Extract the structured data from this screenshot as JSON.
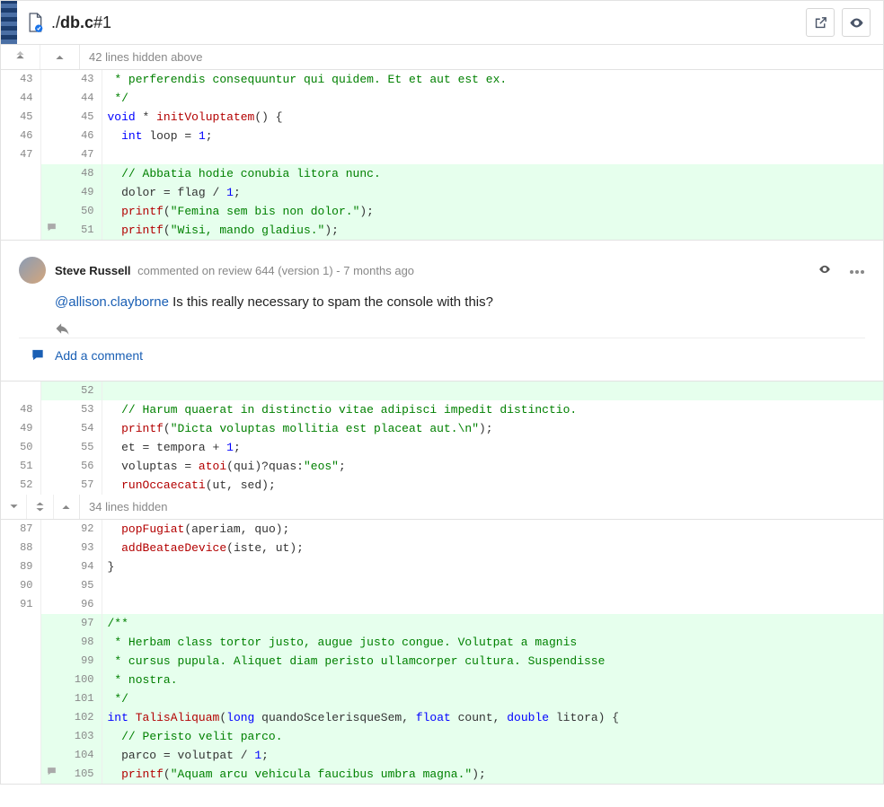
{
  "header": {
    "path_prefix": "./",
    "filename": "db.c",
    "rev_suffix": "#1"
  },
  "collapse_top": "42 lines hidden above",
  "collapse_mid": "34 lines hidden",
  "code_block1": [
    {
      "o": "43",
      "n": "43",
      "t": "ctx",
      "html": " <span class='cm'>* perferendis consequuntur qui quidem. Et et aut est ex.</span>"
    },
    {
      "o": "44",
      "n": "44",
      "t": "ctx",
      "html": " <span class='cm'>*/</span>"
    },
    {
      "o": "45",
      "n": "45",
      "t": "ctx",
      "html": "<span class='kw'>void</span> * <span class='fn'>initVoluptatem</span>() {"
    },
    {
      "o": "46",
      "n": "46",
      "t": "ctx",
      "html": "  <span class='kw'>int</span> loop = <span class='num'>1</span>;"
    },
    {
      "o": "47",
      "n": "47",
      "t": "ctx",
      "html": ""
    },
    {
      "o": "",
      "n": "48",
      "t": "added",
      "html": "  <span class='cm'>// Abbatia hodie conubia litora nunc.</span>"
    },
    {
      "o": "",
      "n": "49",
      "t": "added",
      "html": "  dolor = flag / <span class='num'>1</span>;"
    },
    {
      "o": "",
      "n": "50",
      "t": "added",
      "html": "  <span class='fn'>printf</span>(<span class='str'>\"Femina sem bis non dolor.\"</span>);"
    },
    {
      "o": "",
      "n": "51",
      "t": "added",
      "gutter": "bubble",
      "html": "  <span class='fn'>printf</span>(<span class='str'>\"Wisi, mando gladius.\"</span>);"
    }
  ],
  "comment": {
    "author": "Steve Russell",
    "verb": "commented",
    "context": "on review 644 (version 1)",
    "sep": " - ",
    "age": "7 months ago",
    "mention": "@allison.clayborne",
    "body_rest": " Is this really necessary to spam the console with this?",
    "add_label": "Add a comment"
  },
  "code_block2": [
    {
      "o": "",
      "n": "52",
      "t": "added",
      "html": ""
    },
    {
      "o": "48",
      "n": "53",
      "t": "ctx",
      "html": "  <span class='cm'>// Harum quaerat in distinctio vitae adipisci impedit distinctio.</span>"
    },
    {
      "o": "49",
      "n": "54",
      "t": "ctx",
      "html": "  <span class='fn'>printf</span>(<span class='str'>\"Dicta voluptas mollitia est placeat aut.\\n\"</span>);"
    },
    {
      "o": "50",
      "n": "55",
      "t": "ctx",
      "html": "  et = tempora + <span class='num'>1</span>;"
    },
    {
      "o": "51",
      "n": "56",
      "t": "ctx",
      "html": "  voluptas = <span class='fn'>atoi</span>(qui)?quas:<span class='str'>\"eos\"</span>;"
    },
    {
      "o": "52",
      "n": "57",
      "t": "ctx",
      "html": "  <span class='fn'>runOccaecati</span>(ut, sed);"
    }
  ],
  "code_block3": [
    {
      "o": "87",
      "n": "92",
      "t": "ctx",
      "html": "  <span class='fn'>popFugiat</span>(aperiam, quo);"
    },
    {
      "o": "88",
      "n": "93",
      "t": "ctx",
      "html": "  <span class='fn'>addBeataeDevice</span>(iste, ut);"
    },
    {
      "o": "89",
      "n": "94",
      "t": "ctx",
      "html": "}"
    },
    {
      "o": "90",
      "n": "95",
      "t": "ctx",
      "html": ""
    },
    {
      "o": "91",
      "n": "96",
      "t": "ctx",
      "html": ""
    },
    {
      "o": "",
      "n": "97",
      "t": "added",
      "html": "<span class='cm'>/**</span>"
    },
    {
      "o": "",
      "n": "98",
      "t": "added",
      "html": " <span class='cm'>* Herbam class tortor justo, augue justo congue. Volutpat a magnis</span>"
    },
    {
      "o": "",
      "n": "99",
      "t": "added",
      "html": " <span class='cm'>* cursus pupula. Aliquet diam peristo ullamcorper cultura. Suspendisse</span>"
    },
    {
      "o": "",
      "n": "100",
      "t": "added",
      "html": " <span class='cm'>* nostra.</span>"
    },
    {
      "o": "",
      "n": "101",
      "t": "added",
      "html": " <span class='cm'>*/</span>"
    },
    {
      "o": "",
      "n": "102",
      "t": "added",
      "html": "<span class='kw'>int</span> <span class='fn'>TalisAliquam</span>(<span class='kw'>long</span> quandoScelerisqueSem, <span class='kw'>float</span> count, <span class='kw'>double</span> litora) {"
    },
    {
      "o": "",
      "n": "103",
      "t": "added",
      "html": "  <span class='cm'>// Peristo velit parco.</span>"
    },
    {
      "o": "",
      "n": "104",
      "t": "added",
      "html": "  parco = volutpat / <span class='num'>1</span>;"
    },
    {
      "o": "",
      "n": "105",
      "t": "added",
      "gutter": "bubble",
      "html": "  <span class='fn'>printf</span>(<span class='str'>\"Aquam arcu vehicula faucibus umbra magna.\"</span>);"
    }
  ]
}
